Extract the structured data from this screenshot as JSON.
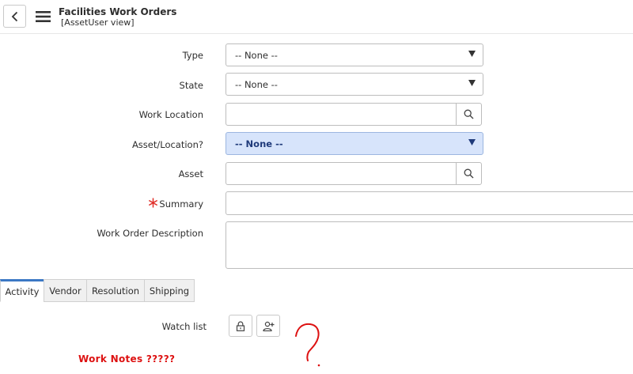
{
  "header": {
    "title": "Facilities Work Orders",
    "subtitle": "[AssetUser view]"
  },
  "form": {
    "type": {
      "label": "Type",
      "value": "-- None --"
    },
    "state": {
      "label": "State",
      "value": "-- None --"
    },
    "work_location": {
      "label": "Work Location",
      "value": ""
    },
    "asset_location": {
      "label": "Asset/Location?",
      "value": "-- None --"
    },
    "asset": {
      "label": "Asset",
      "value": ""
    },
    "summary": {
      "label": "Summary",
      "value": "",
      "required": true
    },
    "description": {
      "label": "Work Order Description",
      "value": ""
    }
  },
  "tabs": [
    {
      "label": "Activity",
      "active": true
    },
    {
      "label": "Vendor",
      "active": false
    },
    {
      "label": "Resolution",
      "active": false
    },
    {
      "label": "Shipping",
      "active": false
    }
  ],
  "activity": {
    "watch_list_label": "Watch list",
    "icons": [
      "lock-icon",
      "add-user-icon"
    ]
  },
  "annotation": {
    "text": "Work Notes ?????",
    "color": "#dd1111"
  },
  "colors": {
    "accent": "#3b78c4",
    "highlight": "#d7e4fb",
    "required": "#e0302a"
  }
}
